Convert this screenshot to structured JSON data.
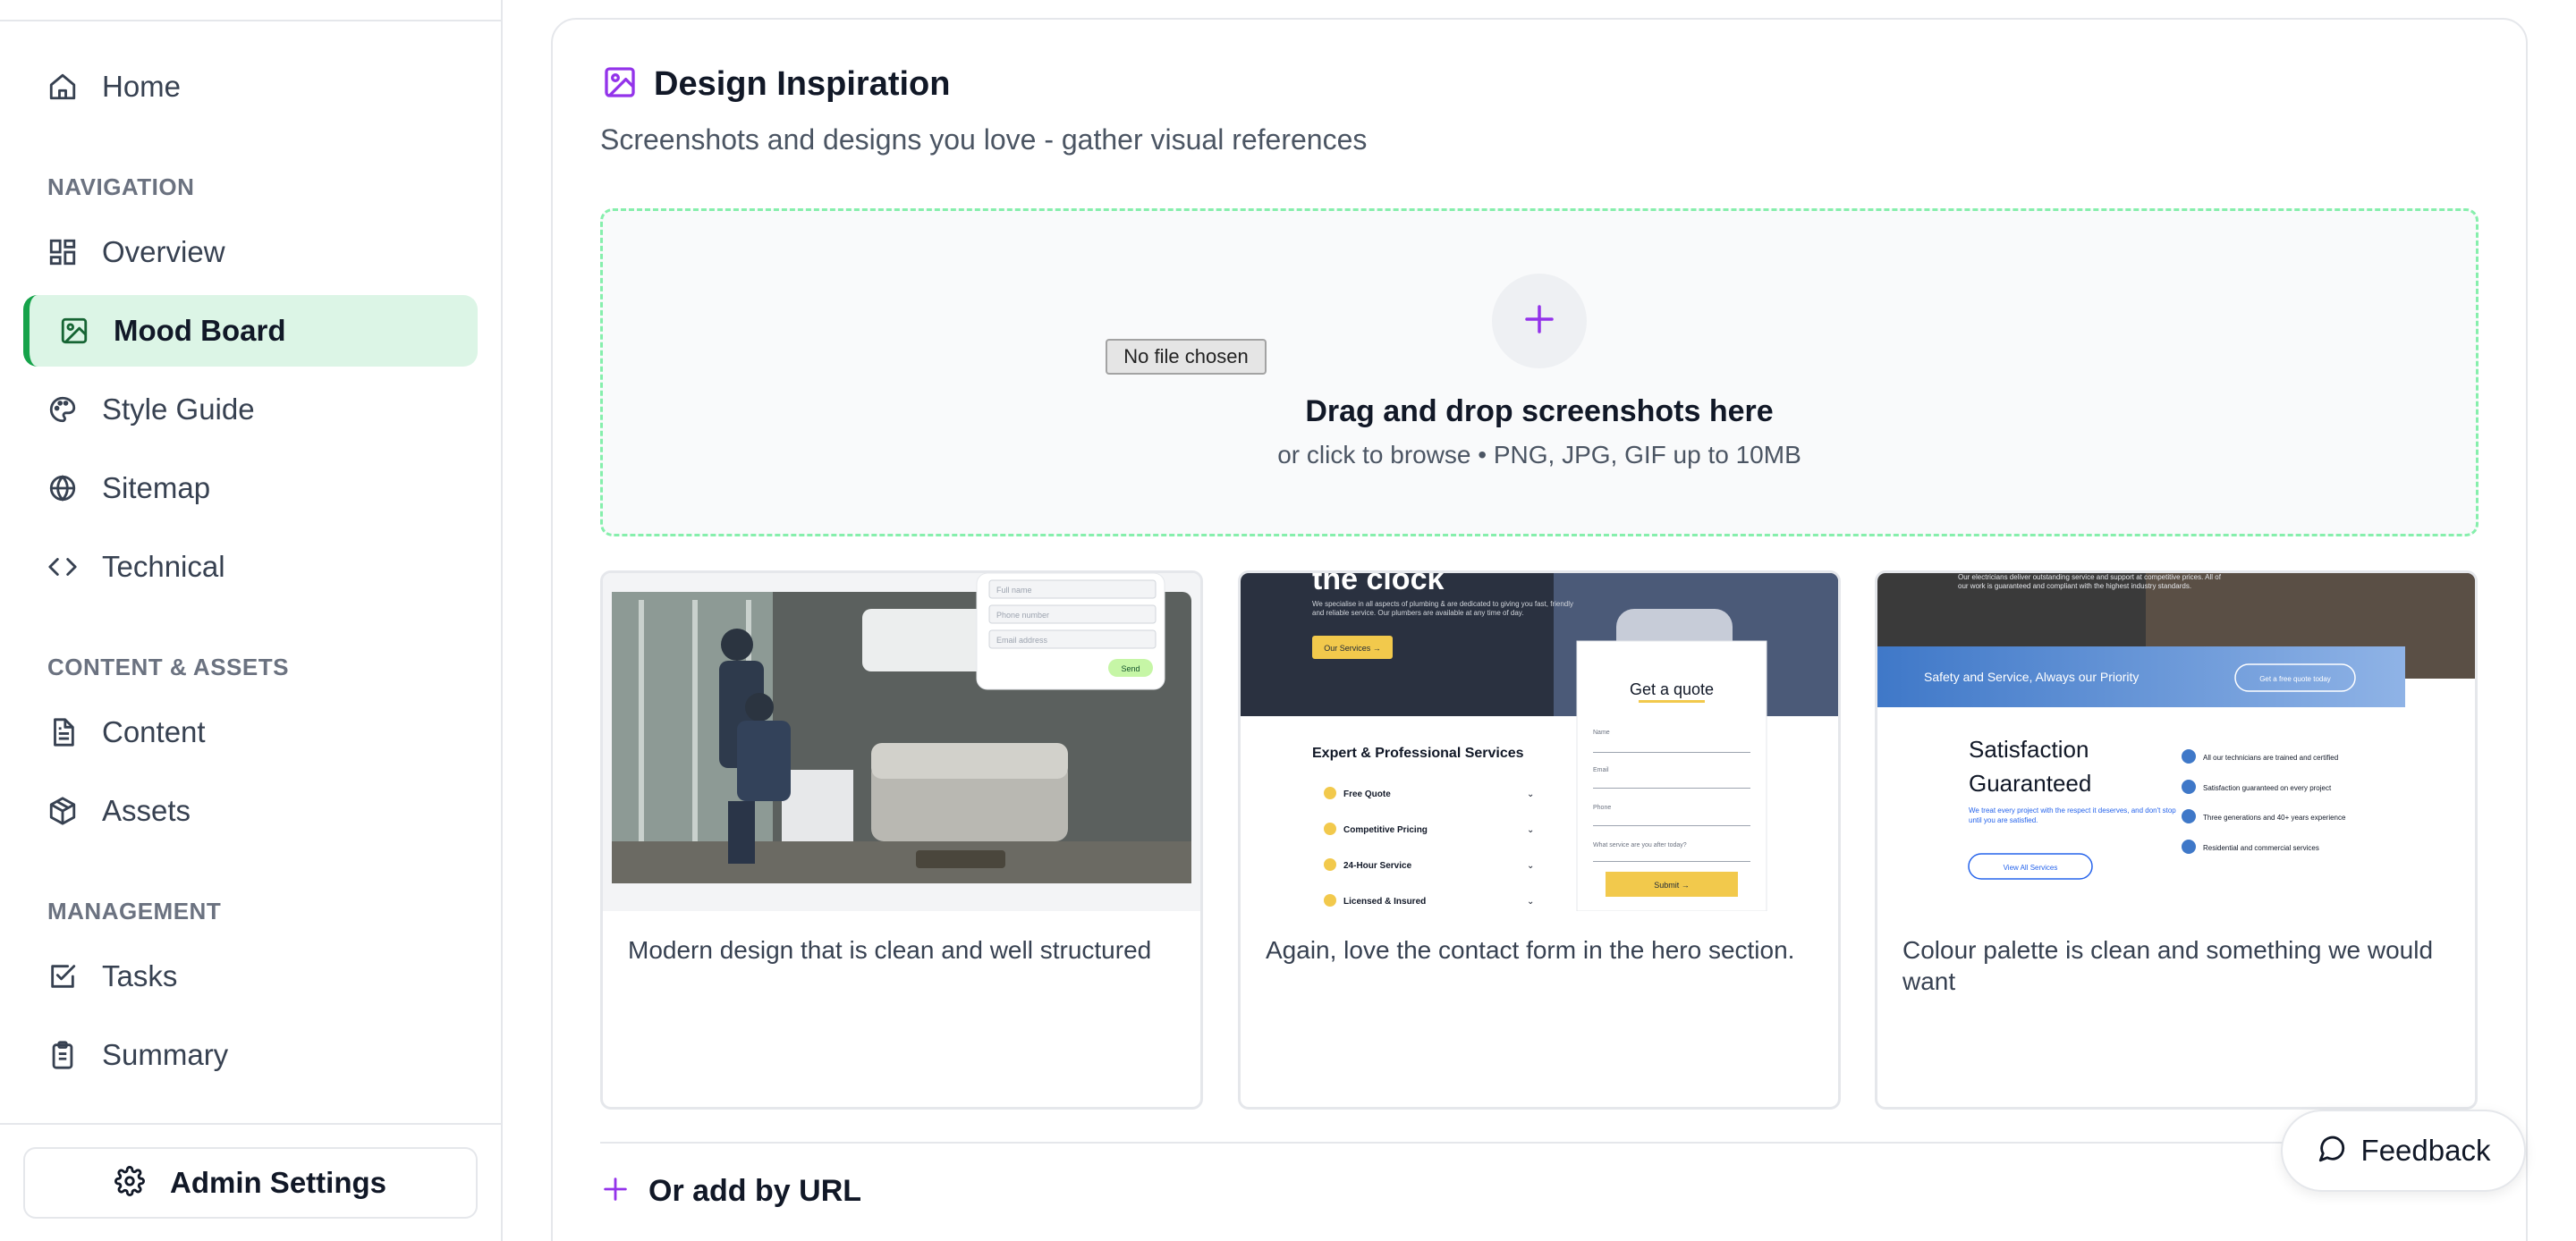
{
  "sidebar": {
    "home": "Home",
    "sections": {
      "navigation": "NAVIGATION",
      "content_assets": "CONTENT & ASSETS",
      "management": "MANAGEMENT"
    },
    "items": {
      "overview": "Overview",
      "mood_board": "Mood Board",
      "style_guide": "Style Guide",
      "sitemap": "Sitemap",
      "technical": "Technical",
      "content": "Content",
      "assets": "Assets",
      "tasks": "Tasks",
      "summary": "Summary"
    },
    "admin_settings": "Admin Settings"
  },
  "main": {
    "title": "Design Inspiration",
    "subtitle": "Screenshots and designs you love - gather visual references",
    "upload": {
      "file_button": "No file chosen",
      "title": "Drag and drop screenshots here",
      "hint": "or click to browse • PNG, JPG, GIF up to 10MB"
    },
    "cards": [
      {
        "caption": "Modern design that is clean and well structured",
        "thumb": {
          "send": "Send",
          "field1": "Full name",
          "field2": "Phone number",
          "field3": "Email address"
        }
      },
      {
        "caption": "Again, love the contact form in the hero section.",
        "thumb": {
          "heading": "the clock",
          "blurb": "We specialise in all aspects of plumbing & are dedicated to giving you fast, friendly and reliable service. Our plumbers are available at any time of day.",
          "button": "Our Services →",
          "services_title": "Expert & Professional Services",
          "services": [
            "Free Quote",
            "Competitive Pricing",
            "24-Hour Service",
            "Licensed & Insured"
          ],
          "quote_title": "Get a quote",
          "quote_fields": [
            "Name",
            "Email",
            "Phone",
            "What service are you after today?"
          ],
          "submit": "Submit →"
        }
      },
      {
        "caption": "Colour palette is clean and something we would want",
        "thumb": {
          "top_text": "Our electricians deliver outstanding service and support at competitive prices. All of our work is guaranteed and compliant with the highest industry standards.",
          "banner": "Safety and Service, Always our Priority",
          "banner_button": "Get a free quote today",
          "heading_line1": "Satisfaction",
          "heading_line2": "Guaranteed",
          "blurb": "We treat every project with the respect it deserves, and don't stop until you are satisfied.",
          "link": "View All Services",
          "bullets": [
            "All our technicians are trained and certified",
            "Satisfaction guaranteed on every project",
            "Three generations and 40+ years experience",
            "Residential and commercial services"
          ]
        }
      }
    ],
    "add_url": "Or add by URL"
  },
  "feedback": "Feedback",
  "colors": {
    "accent_purple": "#9333ea",
    "active_green_bg": "#dcf5e6",
    "active_green_border": "#16a34a",
    "dropzone_border": "#86efac"
  }
}
